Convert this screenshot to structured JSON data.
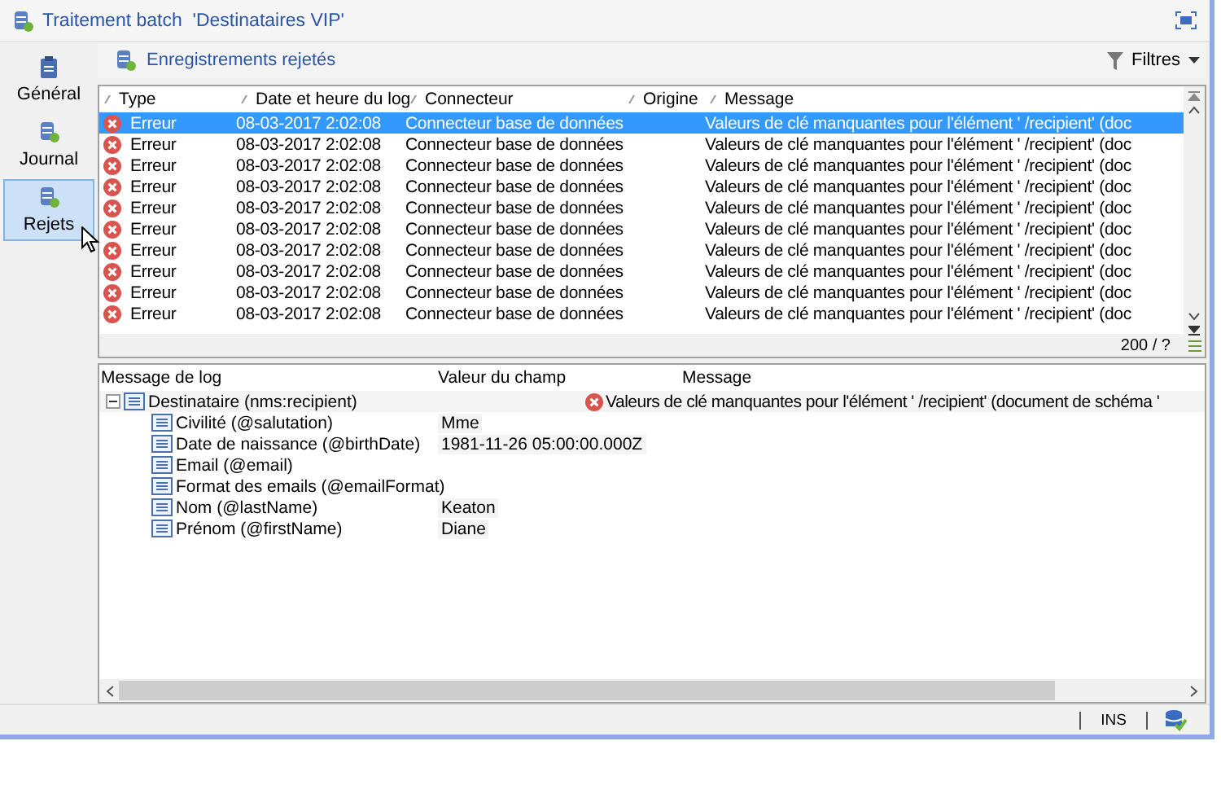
{
  "window": {
    "title": "Traitement batch  'Destinataires VIP'"
  },
  "sidebar": {
    "items": [
      {
        "label": "Général",
        "selected": false
      },
      {
        "label": "Journal",
        "selected": false
      },
      {
        "label": "Rejets",
        "selected": true
      }
    ]
  },
  "toolbar": {
    "title": "Enregistrements rejetés",
    "filter_button": "Filtres"
  },
  "table": {
    "columns": [
      "Type",
      "Date et heure du log",
      "Connecteur",
      "Origine",
      "Message"
    ],
    "rows": [
      {
        "selected": true,
        "type": "Erreur",
        "date": "08-03-2017 2:02:08",
        "connector": "Connecteur base de données",
        "message": "Valeurs de clé manquantes pour l'élément ' /recipient' (doc"
      },
      {
        "selected": false,
        "type": "Erreur",
        "date": "08-03-2017 2:02:08",
        "connector": "Connecteur base de données",
        "message": "Valeurs de clé manquantes pour l'élément ' /recipient' (doc"
      },
      {
        "selected": false,
        "type": "Erreur",
        "date": "08-03-2017 2:02:08",
        "connector": "Connecteur base de données",
        "message": "Valeurs de clé manquantes pour l'élément ' /recipient' (doc"
      },
      {
        "selected": false,
        "type": "Erreur",
        "date": "08-03-2017 2:02:08",
        "connector": "Connecteur base de données",
        "message": "Valeurs de clé manquantes pour l'élément ' /recipient' (doc"
      },
      {
        "selected": false,
        "type": "Erreur",
        "date": "08-03-2017 2:02:08",
        "connector": "Connecteur base de données",
        "message": "Valeurs de clé manquantes pour l'élément ' /recipient' (doc"
      },
      {
        "selected": false,
        "type": "Erreur",
        "date": "08-03-2017 2:02:08",
        "connector": "Connecteur base de données",
        "message": "Valeurs de clé manquantes pour l'élément ' /recipient' (doc"
      },
      {
        "selected": false,
        "type": "Erreur",
        "date": "08-03-2017 2:02:08",
        "connector": "Connecteur base de données",
        "message": "Valeurs de clé manquantes pour l'élément ' /recipient' (doc"
      },
      {
        "selected": false,
        "type": "Erreur",
        "date": "08-03-2017 2:02:08",
        "connector": "Connecteur base de données",
        "message": "Valeurs de clé manquantes pour l'élément ' /recipient' (doc"
      },
      {
        "selected": false,
        "type": "Erreur",
        "date": "08-03-2017 2:02:08",
        "connector": "Connecteur base de données",
        "message": "Valeurs de clé manquantes pour l'élément ' /recipient' (doc"
      },
      {
        "selected": false,
        "type": "Erreur",
        "date": "08-03-2017 2:02:08",
        "connector": "Connecteur base de données",
        "message": "Valeurs de clé manquantes pour l'élément ' /recipient' (doc"
      }
    ],
    "count": "200 / ?"
  },
  "detail": {
    "columns": [
      "Message de log",
      "Valeur du champ",
      "Message"
    ],
    "tree": [
      {
        "label": "Destinataire (nms:recipient)",
        "message": "Valeurs de clé manquantes pour l'élément ' /recipient' (document de schéma '",
        "expanded": true,
        "children": [
          {
            "label": "Civilité (@salutation)",
            "value": "Mme"
          },
          {
            "label": "Date de naissance (@birthDate)",
            "value": "1981-11-26 05:00:00.000Z"
          },
          {
            "label": "Email (@email)"
          },
          {
            "label": "Format des emails (@emailFormat)"
          },
          {
            "label": "Nom (@lastName)",
            "value": "Keaton"
          },
          {
            "label": "Prénom (@firstName)",
            "value": "Diane"
          }
        ]
      }
    ]
  },
  "status_bar": {
    "mode": "INS"
  }
}
